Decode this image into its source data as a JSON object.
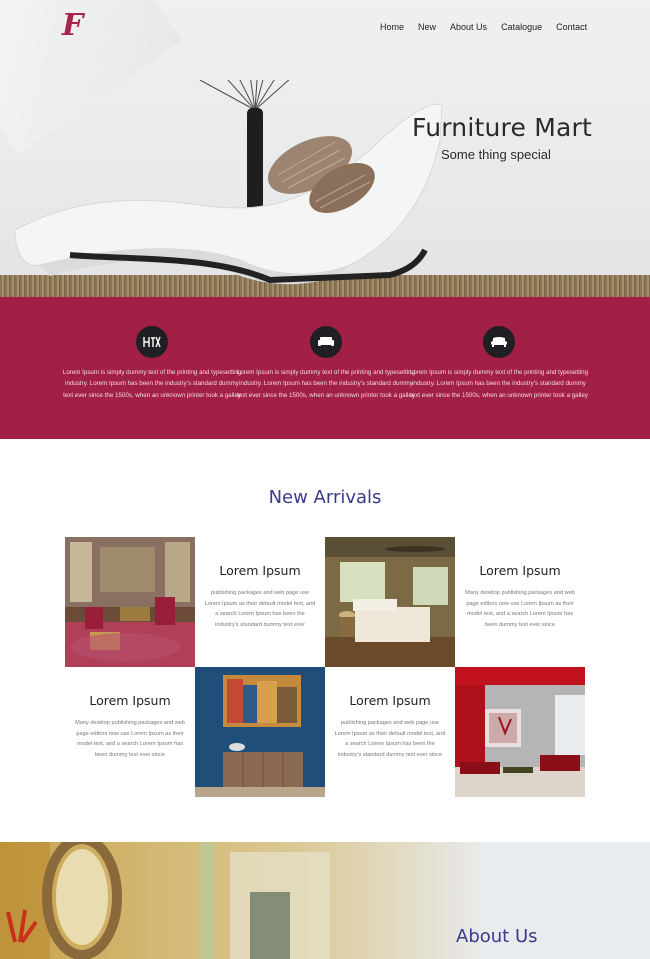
{
  "brand": {
    "logo_glyph": "F",
    "accent": "#a21f45"
  },
  "nav": {
    "items": [
      "Home",
      "New",
      "About Us",
      "Catalogue",
      "Contact"
    ]
  },
  "hero": {
    "title": "Furniture Mart",
    "subtitle": "Some thing special"
  },
  "features": [
    {
      "icon": "furniture-icon",
      "text": "Lorem Ipsum is simply dummy text of the printing and typesetting industry. Lorem Ipsum has been the industry's standard dummy text ever since the 1500s, when an unknown printer took a galley"
    },
    {
      "icon": "sofa-icon",
      "text": "Lorem Ipsum is simply dummy text of the printing and typesetting industry. Lorem Ipsum has been the industry's standard dummy text ever since the 1500s, when an unknown printer took a galley"
    },
    {
      "icon": "couch-icon",
      "text": "Lorem Ipsum is simply dummy text of the printing and typesetting industry. Lorem Ipsum has been the industry's standard dummy text ever since the 1500s, when an unknown printer took a galley"
    }
  ],
  "new_arrivals": {
    "title": "New Arrivals",
    "cards": [
      {
        "title": "Lorem Ipsum",
        "text": "publishing packages and web page use Lorem Ipsum as their default model text, and a search Lorem Ipsum has been the industry's standard dummy text ever"
      },
      {
        "title": "Lorem Ipsum",
        "text": "Many desktop publishing packages and web page editors now use Lorem Ipsum as their model text, and a search Lorem Ipsum has been dummy text ever since"
      },
      {
        "title": "Lorem Ipsum",
        "text": "Many desktop publishing packages and web page editors now use Lorem Ipsum as their model text, and a search Lorem Ipsum has been dummy text ever since"
      },
      {
        "title": "Lorem Ipsum",
        "text": "publishing packages and web page use Lorem Ipsum as their default model text, and a search Lorem Ipsum has been the industry's standard dummy text ever since"
      }
    ]
  },
  "about": {
    "title": "About Us"
  }
}
